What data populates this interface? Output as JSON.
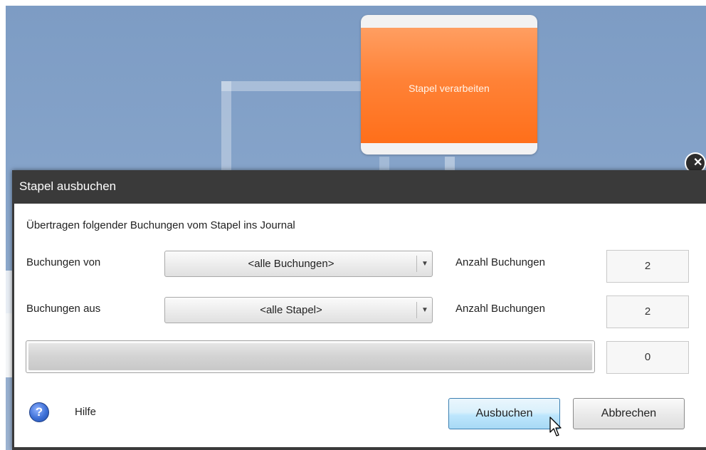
{
  "canvas": {
    "process_node_label": "Stapel verarbeiten"
  },
  "dialog": {
    "title": "Stapel ausbuchen",
    "intro": "Übertragen folgender Buchungen vom Stapel ins Journal",
    "rows": [
      {
        "label": "Buchungen von",
        "selected": "<alle Buchungen>",
        "count_label": "Anzahl Buchungen",
        "count": "2"
      },
      {
        "label": "Buchungen aus",
        "selected": "<alle Stapel>",
        "count_label": "Anzahl Buchungen",
        "count": "2"
      }
    ],
    "progress": {
      "value_fraction": 0,
      "count": "0"
    },
    "help_label": "Hilfe",
    "buttons": {
      "ok": "Ausbuchen",
      "cancel": "Abbrechen"
    }
  },
  "icons": {
    "close": "close-icon",
    "help": "help-icon",
    "dropdown": "chevron-down-icon",
    "cursor": "mouse-pointer-icon"
  },
  "colors": {
    "node_orange": "#ff7a2a",
    "title_bar": "#3a3a3a",
    "primary_button": "#bee6fd",
    "canvas_blue": "#86a4ca"
  }
}
